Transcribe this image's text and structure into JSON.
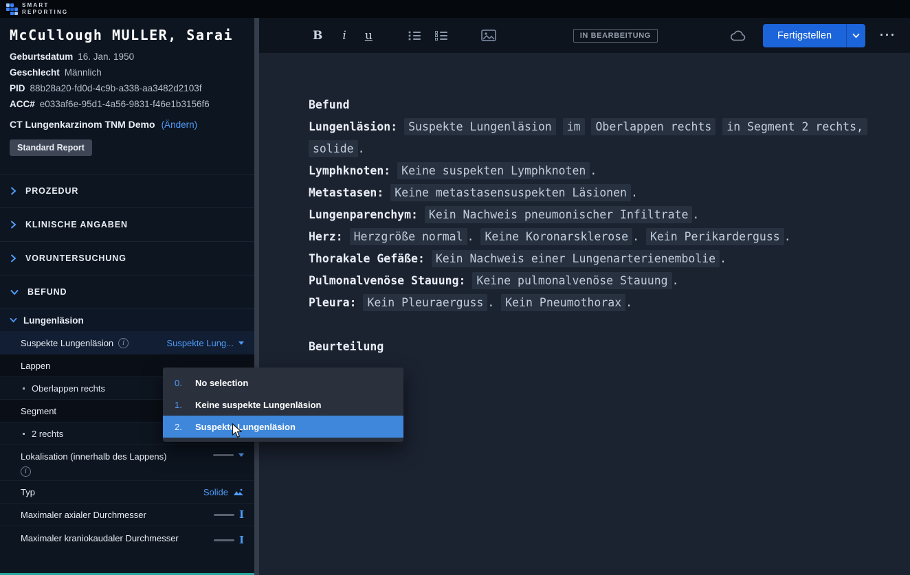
{
  "brand": {
    "top": "SMART",
    "bottom": "REPORTING"
  },
  "patient": {
    "name": "McCullough MULLER, Sarai",
    "fields": [
      {
        "label": "Geburtsdatum",
        "value": "16. Jan. 1950"
      },
      {
        "label": "Geschlecht",
        "value": "Männlich"
      },
      {
        "label": "PID",
        "value": "88b28a20-fd0d-4c9b-a338-aa3482d2103f"
      },
      {
        "label": "ACC#",
        "value": "e033af6e-95d1-4a56-9831-f46e1b3156f6"
      }
    ]
  },
  "template_info": {
    "name": "CT Lungenkarzinom TNM Demo",
    "change_link": "(Ändern)",
    "badge": "Standard Report"
  },
  "nav": {
    "sections": [
      {
        "label": "PROZEDUR"
      },
      {
        "label": "KLINISCHE ANGABEN"
      },
      {
        "label": "VORUNTERSUCHUNG"
      },
      {
        "label": "BEFUND"
      }
    ]
  },
  "befund_panel": {
    "group_label": "Lungenläsion",
    "suspekte_label": "Suspekte Lungenläsion",
    "suspekte_value": "Suspekte Lung...",
    "lappen_label": "Lappen",
    "lappen_item": "Oberlappen rechts",
    "segment_label": "Segment",
    "segment_item": "2 rechts",
    "lokalisation_label": "Lokalisation (innerhalb des Lappens)",
    "typ_label": "Typ",
    "typ_value": "Solide",
    "axial_label": "Maximaler axialer Durchmesser",
    "kranio_label": "Maximaler kraniokaudaler Durchmesser"
  },
  "dropdown": {
    "selected_index": 2,
    "options": [
      {
        "num": "0.",
        "label": "No selection"
      },
      {
        "num": "1.",
        "label": "Keine suspekte Lungenläsion"
      },
      {
        "num": "2.",
        "label": "Suspekte Lungenläsion"
      }
    ]
  },
  "toolbar": {
    "bold": "B",
    "italic": "i",
    "underline": "u",
    "status": "IN BEARBEITUNG",
    "finish": "Fertigstellen",
    "more": "···"
  },
  "icons": {
    "info": "i",
    "text_cursor": "I"
  },
  "report": {
    "findings_heading": "Befund",
    "assessment_heading": "Beurteilung",
    "lines": [
      {
        "s": [
          "Lungenläsion:",
          "Suspekte Lungenläsion",
          "im",
          "Oberlappen rechts",
          "in Segment 2 rechts,"
        ]
      },
      {
        "s": [
          "solide",
          "."
        ]
      },
      {
        "s": [
          "Lymphknoten:",
          "Keine suspekten Lymphknoten",
          "."
        ]
      },
      {
        "s": [
          "Metastasen:",
          "Keine metastasensuspekten Läsionen",
          "."
        ]
      },
      {
        "s": [
          "Lungenparenchym:",
          "Kein Nachweis pneumonischer Infiltrate",
          "."
        ]
      },
      {
        "s": [
          "Herz:",
          "Herzgröße normal",
          ".",
          "Keine Koronarsklerose",
          ".",
          "Kein Perikarderguss",
          "."
        ]
      },
      {
        "s": [
          "Thorakale Gefäße:",
          "Kein Nachweis einer Lungenarterienembolie",
          "."
        ]
      },
      {
        "s": [
          "Pulmonalvenöse Stauung:",
          "Keine pulmonalvenöse Stauung",
          "."
        ]
      },
      {
        "s": [
          "Pleura:",
          "Kein Pleuraerguss",
          ".",
          "Kein Pneumothorax",
          "."
        ]
      }
    ]
  },
  "colors": {
    "accent_blue": "#4f9cf9",
    "primary_button": "#1c64da",
    "selected_option": "#3e87da",
    "chip_background": "#283140",
    "teal_bar": "#27a49d"
  }
}
